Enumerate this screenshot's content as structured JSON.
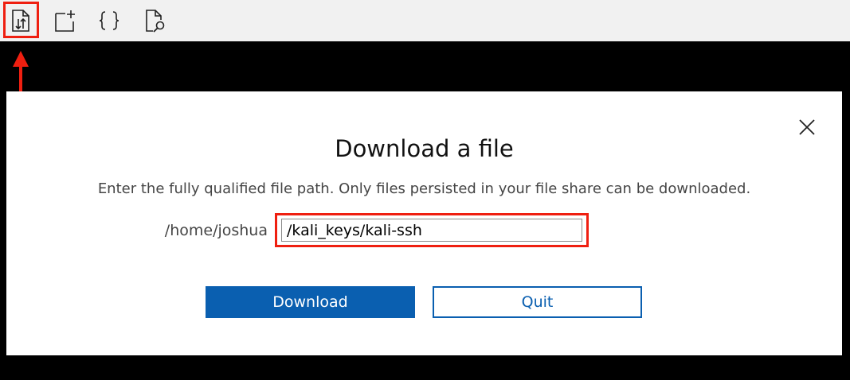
{
  "toolbar": {
    "buttons": [
      {
        "icon": "file-transfer-icon"
      },
      {
        "icon": "new-file-icon"
      },
      {
        "icon": "braces-icon"
      },
      {
        "icon": "file-search-icon"
      }
    ]
  },
  "dialog": {
    "title": "Download a file",
    "description": "Enter the fully qualified file path. Only files persisted in your file share can be downloaded.",
    "path_prefix": "/home/joshua",
    "path_value": "/kali_keys/kali-ssh",
    "download_label": "Download",
    "quit_label": "Quit"
  },
  "colors": {
    "annotation": "#ef1f10",
    "primary": "#0a5fb0",
    "toolbar_bg": "#f1f1f1",
    "backdrop": "#000000"
  }
}
